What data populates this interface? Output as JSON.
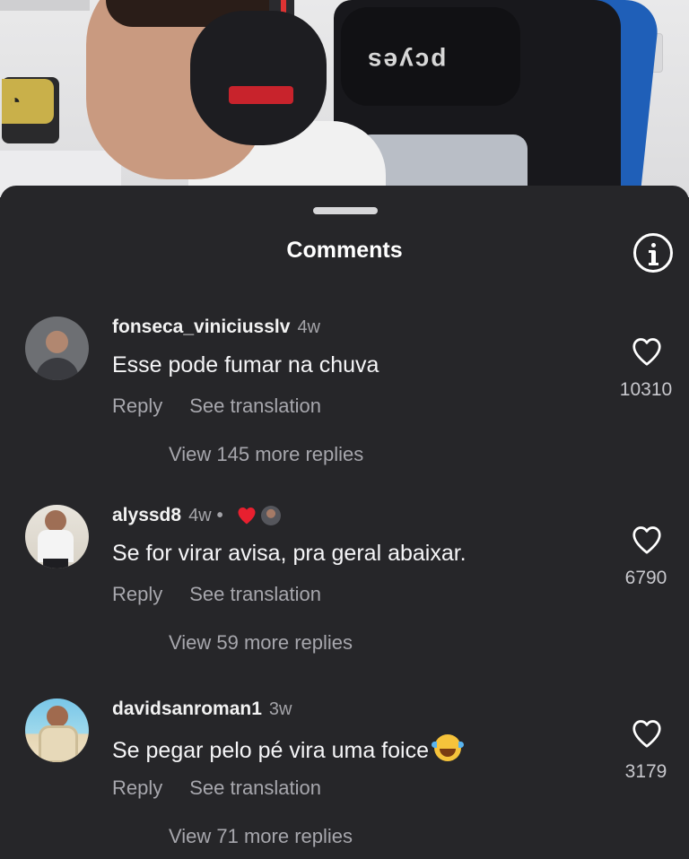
{
  "sheet": {
    "title": "Comments",
    "info_icon": "info-icon"
  },
  "comments": [
    {
      "username": "fonseca_viniciusslv",
      "time": "4w",
      "text": "Esse pode fumar na chuva",
      "reply_label": "Reply",
      "translate_label": "See translation",
      "view_replies": "View 145 more replies",
      "likes": "10310",
      "like_icon": "heart-outline-icon"
    },
    {
      "username": "alyssd8",
      "time": "4w",
      "separator": "•",
      "liked_by_creator_icon": "red-heart-icon",
      "text": "Se for virar avisa, pra geral abaixar.",
      "reply_label": "Reply",
      "translate_label": "See translation",
      "view_replies": "View 59 more replies",
      "likes": "6790",
      "like_icon": "heart-outline-icon"
    },
    {
      "username": "davidsanroman1",
      "time": "3w",
      "text": "Se pegar pelo pé vira uma foice",
      "emoji_icon": "laughing-tears-emoji",
      "reply_label": "Reply",
      "translate_label": "See translation",
      "view_replies": "View 71 more replies",
      "likes": "3179",
      "like_icon": "heart-outline-icon"
    }
  ],
  "colors": {
    "sheet_bg": "#262629",
    "primary_text": "#f5f5f7",
    "secondary_text": "#a7a7ad",
    "heart_red": "#e8202f"
  }
}
